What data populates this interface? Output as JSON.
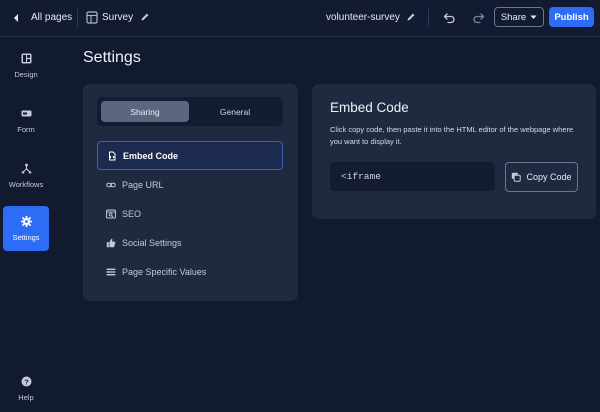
{
  "topbar": {
    "all_pages": "All pages",
    "page_name": "Survey",
    "slug": "volunteer-survey",
    "share_label": "Share",
    "publish_label": "Publish"
  },
  "sidebar": {
    "items": [
      {
        "label": "Design",
        "icon": "layout-icon"
      },
      {
        "label": "Form",
        "icon": "form-icon"
      },
      {
        "label": "Workflows",
        "icon": "workflow-icon"
      },
      {
        "label": "Settings",
        "icon": "gear-icon",
        "active": true
      }
    ],
    "help_label": "Help"
  },
  "main": {
    "title": "Settings",
    "tabs": [
      {
        "label": "Sharing",
        "active": true
      },
      {
        "label": "General",
        "active": false
      }
    ],
    "menu": [
      {
        "label": "Embed Code",
        "icon": "embed-icon",
        "active": true
      },
      {
        "label": "Page URL",
        "icon": "link-icon"
      },
      {
        "label": "SEO",
        "icon": "seo-icon"
      },
      {
        "label": "Social Settings",
        "icon": "thumbs-up-icon"
      },
      {
        "label": "Page Specific Values",
        "icon": "list-icon"
      }
    ]
  },
  "embed": {
    "title": "Embed Code",
    "description": "Click copy code, then paste it into the HTML editor of the webpage where you want to display it.",
    "code": "<iframe",
    "copy_label": "Copy Code"
  },
  "colors": {
    "background": "#111a2f",
    "panel": "#1f2a40",
    "accent": "#2f6cf5"
  }
}
